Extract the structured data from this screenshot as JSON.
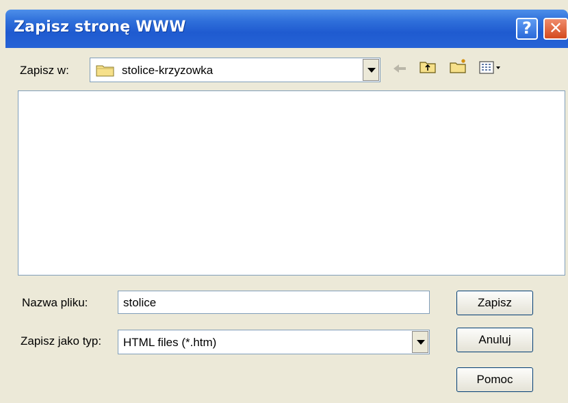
{
  "window": {
    "title": "Zapisz stronę WWW"
  },
  "titlebar_buttons": {
    "help": "?",
    "close": "✕"
  },
  "save_in": {
    "label": "Zapisz w:",
    "folder": "stolice-krzyzowka",
    "icon": "folder-icon"
  },
  "toolbar": {
    "icons": [
      "back-arrow-icon",
      "up-folder-icon",
      "new-folder-icon",
      "view-menu-icon"
    ]
  },
  "filename": {
    "label": "Nazwa pliku:",
    "value": "stolice"
  },
  "filetype": {
    "label": "Zapisz jako typ:",
    "value": "HTML files (*.htm)"
  },
  "buttons": {
    "save": "Zapisz",
    "cancel": "Anuluj",
    "help": "Pomoc"
  }
}
